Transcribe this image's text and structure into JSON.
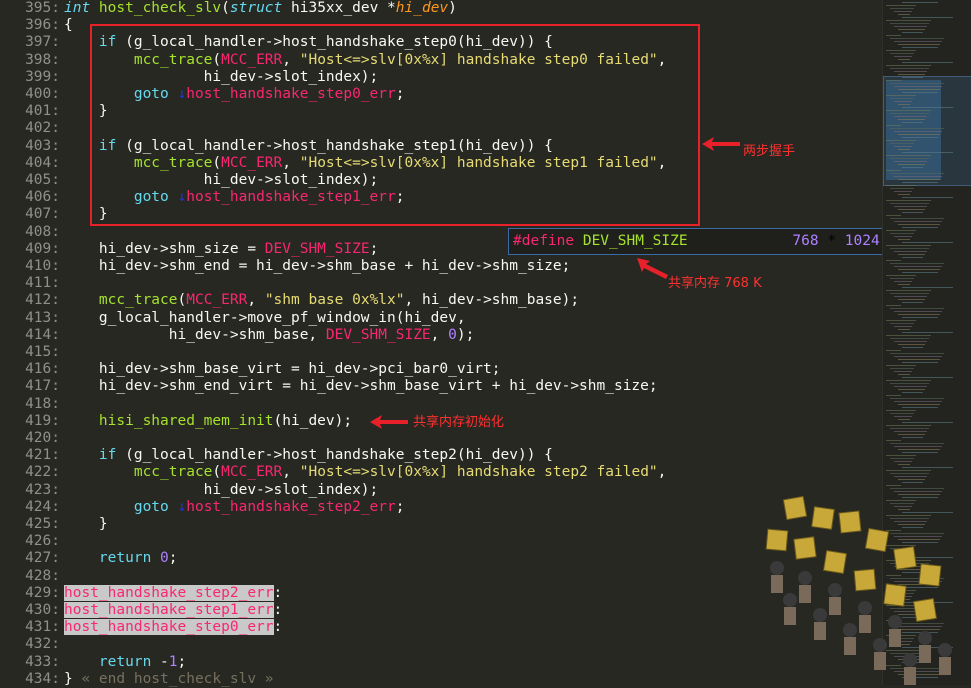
{
  "editor": {
    "lines": [
      {
        "n": "395:",
        "t": [
          [
            "ty",
            "int"
          ],
          [
            "fn",
            " host_check_slv"
          ],
          [
            "",
            "("
          ],
          [
            "ty",
            "struct"
          ],
          [
            "",
            " hi35xx_dev *"
          ],
          [
            "pa",
            "hi_dev"
          ],
          [
            "",
            ")"
          ]
        ]
      },
      {
        "n": "396:",
        "t": [
          [
            "",
            "{"
          ]
        ]
      },
      {
        "n": "397:",
        "t": [
          [
            "",
            "    "
          ],
          [
            "kw",
            "if"
          ],
          [
            "",
            " (g_local_handler->host_handshake_step0(hi_dev)) {"
          ]
        ]
      },
      {
        "n": "398:",
        "t": [
          [
            "",
            "        "
          ],
          [
            "fn",
            "mcc_trace"
          ],
          [
            "",
            "("
          ],
          [
            "mc",
            "MCC_ERR"
          ],
          [
            "",
            ", "
          ],
          [
            "st",
            "\"Host<=>slv[0x%x] handshake step0 failed\""
          ],
          [
            "",
            ","
          ]
        ]
      },
      {
        "n": "399:",
        "t": [
          [
            "",
            "                hi_dev->slot_index);"
          ]
        ]
      },
      {
        "n": "400:",
        "t": [
          [
            "",
            "        "
          ],
          [
            "kw",
            "goto"
          ],
          [
            "gotoarrow",
            " ↓"
          ],
          [
            "mc",
            "host_handshake_step0_err"
          ],
          [
            "",
            ";"
          ]
        ]
      },
      {
        "n": "401:",
        "t": [
          [
            "",
            "    }"
          ]
        ]
      },
      {
        "n": "402:",
        "t": []
      },
      {
        "n": "403:",
        "t": [
          [
            "",
            "    "
          ],
          [
            "kw",
            "if"
          ],
          [
            "",
            " (g_local_handler->host_handshake_step1(hi_dev)) {"
          ]
        ]
      },
      {
        "n": "404:",
        "t": [
          [
            "",
            "        "
          ],
          [
            "fn",
            "mcc_trace"
          ],
          [
            "",
            "("
          ],
          [
            "mc",
            "MCC_ERR"
          ],
          [
            "",
            ", "
          ],
          [
            "st",
            "\"Host<=>slv[0x%x] handshake step1 failed\""
          ],
          [
            "",
            ","
          ]
        ]
      },
      {
        "n": "405:",
        "t": [
          [
            "",
            "                hi_dev->slot_index);"
          ]
        ]
      },
      {
        "n": "406:",
        "t": [
          [
            "",
            "        "
          ],
          [
            "kw",
            "goto"
          ],
          [
            "gotoarrow",
            " ↓"
          ],
          [
            "mc",
            "host_handshake_step1_err"
          ],
          [
            "",
            ";"
          ]
        ]
      },
      {
        "n": "407:",
        "t": [
          [
            "",
            "    }"
          ]
        ]
      },
      {
        "n": "408:",
        "t": []
      },
      {
        "n": "409:",
        "t": [
          [
            "",
            "    hi_dev->shm_size = "
          ],
          [
            "mc",
            "DEV_SHM_SIZE"
          ],
          [
            "",
            ";"
          ]
        ]
      },
      {
        "n": "410:",
        "t": [
          [
            "",
            "    hi_dev->shm_end = hi_dev->shm_base + hi_dev->shm_size;"
          ]
        ]
      },
      {
        "n": "411:",
        "t": []
      },
      {
        "n": "412:",
        "t": [
          [
            "",
            "    "
          ],
          [
            "fn",
            "mcc_trace"
          ],
          [
            "",
            "("
          ],
          [
            "mc",
            "MCC_ERR"
          ],
          [
            "",
            ", "
          ],
          [
            "st",
            "\"shm base 0x%lx\""
          ],
          [
            "",
            ", hi_dev->shm_base);"
          ]
        ]
      },
      {
        "n": "413:",
        "t": [
          [
            "",
            "    g_local_handler->move_pf_window_in(hi_dev,"
          ]
        ]
      },
      {
        "n": "414:",
        "t": [
          [
            "",
            "            hi_dev->shm_base, "
          ],
          [
            "mc",
            "DEV_SHM_SIZE"
          ],
          [
            "",
            ", "
          ],
          [
            "cn",
            "0"
          ],
          [
            "",
            ");"
          ]
        ]
      },
      {
        "n": "415:",
        "t": []
      },
      {
        "n": "416:",
        "t": [
          [
            "",
            "    hi_dev->shm_base_virt = hi_dev->pci_bar0_virt;"
          ]
        ]
      },
      {
        "n": "417:",
        "t": [
          [
            "",
            "    hi_dev->shm_end_virt = hi_dev->shm_base_virt + hi_dev->shm_size;"
          ]
        ]
      },
      {
        "n": "418:",
        "t": []
      },
      {
        "n": "419:",
        "t": [
          [
            "",
            "    "
          ],
          [
            "fn",
            "hisi_shared_mem_init"
          ],
          [
            "",
            "(hi_dev);"
          ]
        ]
      },
      {
        "n": "420:",
        "t": []
      },
      {
        "n": "421:",
        "t": [
          [
            "",
            "    "
          ],
          [
            "kw",
            "if"
          ],
          [
            "",
            " (g_local_handler->host_handshake_step2(hi_dev)) {"
          ]
        ]
      },
      {
        "n": "422:",
        "t": [
          [
            "",
            "        "
          ],
          [
            "fn",
            "mcc_trace"
          ],
          [
            "",
            "("
          ],
          [
            "mc",
            "MCC_ERR"
          ],
          [
            "",
            ", "
          ],
          [
            "st",
            "\"Host<=>slv[0x%x] handshake step2 failed\""
          ],
          [
            "",
            ","
          ]
        ]
      },
      {
        "n": "423:",
        "t": [
          [
            "",
            "                hi_dev->slot_index);"
          ]
        ]
      },
      {
        "n": "424:",
        "t": [
          [
            "",
            "        "
          ],
          [
            "kw",
            "goto"
          ],
          [
            "gotoarrow",
            " ↓"
          ],
          [
            "mc",
            "host_handshake_step2_err"
          ],
          [
            "",
            ";"
          ]
        ]
      },
      {
        "n": "425:",
        "t": [
          [
            "",
            "    }"
          ]
        ]
      },
      {
        "n": "426:",
        "t": []
      },
      {
        "n": "427:",
        "t": [
          [
            "",
            "    "
          ],
          [
            "kw",
            "return"
          ],
          [
            "",
            " "
          ],
          [
            "cn",
            "0"
          ],
          [
            "",
            ";"
          ]
        ]
      },
      {
        "n": "428:",
        "t": []
      },
      {
        "n": "429:",
        "t": [
          [
            "lbl",
            "host_handshake_step2_err"
          ],
          [
            "",
            ":"
          ]
        ]
      },
      {
        "n": "430:",
        "t": [
          [
            "lbl",
            "host_handshake_step1_err"
          ],
          [
            "",
            ":"
          ]
        ]
      },
      {
        "n": "431:",
        "t": [
          [
            "lbl",
            "host_handshake_step0_err"
          ],
          [
            "",
            ":"
          ]
        ]
      },
      {
        "n": "432:",
        "t": []
      },
      {
        "n": "433:",
        "t": [
          [
            "",
            "    "
          ],
          [
            "kw",
            "return"
          ],
          [
            "",
            " -"
          ],
          [
            "cn",
            "1"
          ],
          [
            "",
            ";"
          ]
        ]
      },
      {
        "n": "434:",
        "t": [
          [
            "",
            "} "
          ],
          [
            "dim",
            "« end host_check_slv »"
          ]
        ]
      }
    ]
  },
  "popup": {
    "define_kw": "#define",
    "name": "DEV_SHM_SIZE",
    "value_a": "768",
    "op": "*",
    "value_b": "1024"
  },
  "annotations": {
    "handshake": "两步握手",
    "shm_size": "共享内存 768 K",
    "shm_init": "共享内存初始化"
  },
  "colors": {
    "background": "#272822",
    "annotation_red": "#e8202a",
    "popup_border": "#3c6aa6"
  }
}
